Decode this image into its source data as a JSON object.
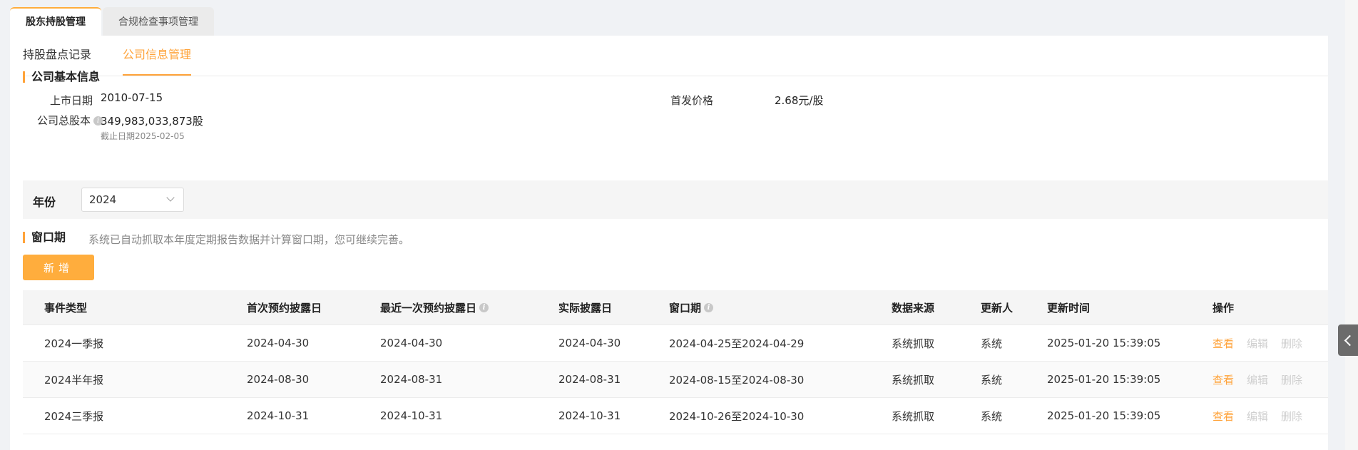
{
  "top_tabs": [
    {
      "label": "股东持股管理",
      "active": true
    },
    {
      "label": "合规检查事项管理",
      "active": false
    }
  ],
  "sub_tabs": [
    {
      "label": "持股盘点记录",
      "active": false
    },
    {
      "label": "公司信息管理",
      "active": true
    }
  ],
  "basic_info": {
    "title": "公司基本信息",
    "listing_date_label": "上市日期",
    "listing_date": "2010-07-15",
    "ipo_price_label": "首发价格",
    "ipo_price": "2.68元/股",
    "total_shares_label": "公司总股本",
    "total_shares": "349,983,033,873股",
    "cutoff": "截止日期2025-02-05"
  },
  "year_filter": {
    "label": "年份",
    "value": "2024"
  },
  "window": {
    "title": "窗口期",
    "description": "系统已自动抓取本年度定期报告数据并计算窗口期，您可继续完善。",
    "add_button": "新增"
  },
  "table": {
    "headers": {
      "event_type": "事件类型",
      "first_appointment": "首次预约披露日",
      "latest_appointment": "最近一次预约披露日",
      "actual": "实际披露日",
      "window": "窗口期",
      "source": "数据来源",
      "updater": "更新人",
      "updated_at": "更新时间",
      "ops": "操作"
    },
    "actions": {
      "view": "查看",
      "edit": "编辑",
      "delete": "删除"
    },
    "rows": [
      {
        "event_type": "2024一季报",
        "first_appointment": "2024-04-30",
        "latest_appointment": "2024-04-30",
        "actual": "2024-04-30",
        "window": "2024-04-25至2024-04-29",
        "source": "系统抓取",
        "updater": "系统",
        "updated_at": "2025-01-20 15:39:05"
      },
      {
        "event_type": "2024半年报",
        "first_appointment": "2024-08-30",
        "latest_appointment": "2024-08-31",
        "actual": "2024-08-31",
        "window": "2024-08-15至2024-08-30",
        "source": "系统抓取",
        "updater": "系统",
        "updated_at": "2025-01-20 15:39:05"
      },
      {
        "event_type": "2024三季报",
        "first_appointment": "2024-10-31",
        "latest_appointment": "2024-10-31",
        "actual": "2024-10-31",
        "window": "2024-10-26至2024-10-30",
        "source": "系统抓取",
        "updater": "系统",
        "updated_at": "2025-01-20 15:39:05"
      }
    ]
  },
  "colors": {
    "accent": "#ffa33a",
    "button": "#ffad3d"
  }
}
